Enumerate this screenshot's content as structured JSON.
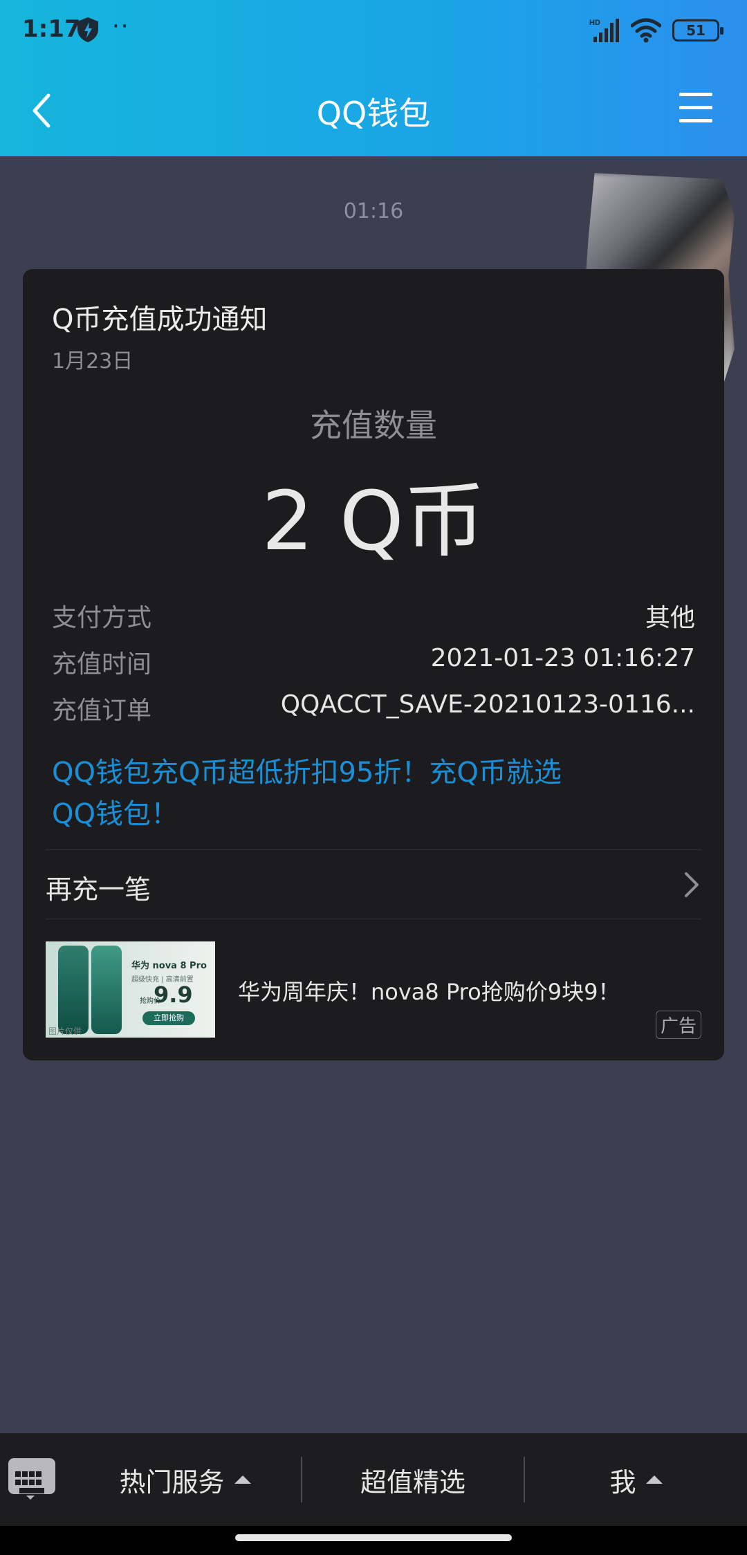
{
  "status_bar": {
    "time": "1:17",
    "dots": "··",
    "network_label": "HD",
    "battery": "51"
  },
  "nav": {
    "title": "QQ钱包"
  },
  "chat": {
    "timestamp": "01:16"
  },
  "card": {
    "title": "Q币充值成功通知",
    "date": "1月23日",
    "amount_label": "充值数量",
    "amount_value": "2 Q币",
    "details": [
      {
        "label": "支付方式",
        "value": "其他"
      },
      {
        "label": "充值时间",
        "value": "2021-01-23 01:16:27"
      },
      {
        "label": "充值订单",
        "value": "QQACCT_SAVE-20210123-0116..."
      }
    ],
    "promo_line1": "QQ钱包充Q币超低折扣95折！充Q币就选",
    "promo_line2": "QQ钱包！",
    "recharge_again": "再充一笔",
    "ad": {
      "image_brand": "华为 nova 8 Pro",
      "image_sub": "超级快充 | 高清前置",
      "image_price_prefix": "抢购价",
      "image_price": "9.9",
      "image_button": "立即抢购",
      "image_watermark": "图片仅供",
      "text": "华为周年庆！nova8 Pro抢购价9块9！",
      "badge": "广告"
    }
  },
  "bottom_bar": {
    "tabs": [
      {
        "label": "热门服务"
      },
      {
        "label": "超值精选"
      },
      {
        "label": "我"
      }
    ]
  },
  "colors": {
    "header_gradient_start": "#16b6dc",
    "header_gradient_end": "#2c8fee",
    "background": "#3b3f50",
    "card": "#1c1c1e",
    "promo_link": "#1a8fd6"
  }
}
